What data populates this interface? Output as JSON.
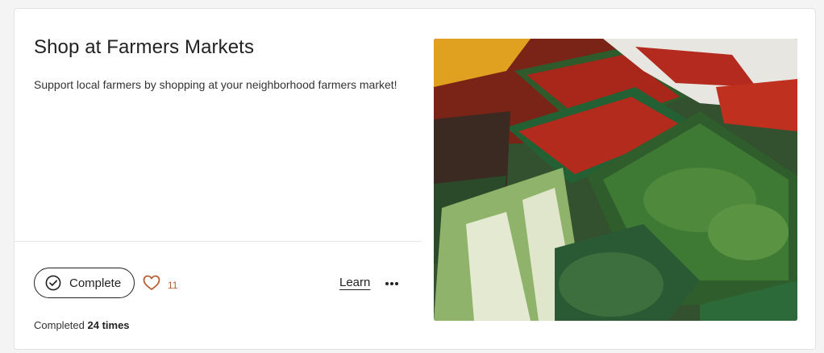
{
  "card": {
    "title": "Shop at Farmers Markets",
    "description": "Support local farmers by shopping at your neighborhood farmers market!",
    "complete_label": "Complete",
    "like_count": "11",
    "learn_label": "Learn",
    "completed_prefix": "Completed",
    "completed_count": "24 times"
  },
  "icons": {
    "complete": "check-circle-icon",
    "like": "heart-icon",
    "more": "more-horizontal-icon"
  },
  "colors": {
    "accent": "#b5603a",
    "text": "#222222",
    "border": "#222222"
  }
}
